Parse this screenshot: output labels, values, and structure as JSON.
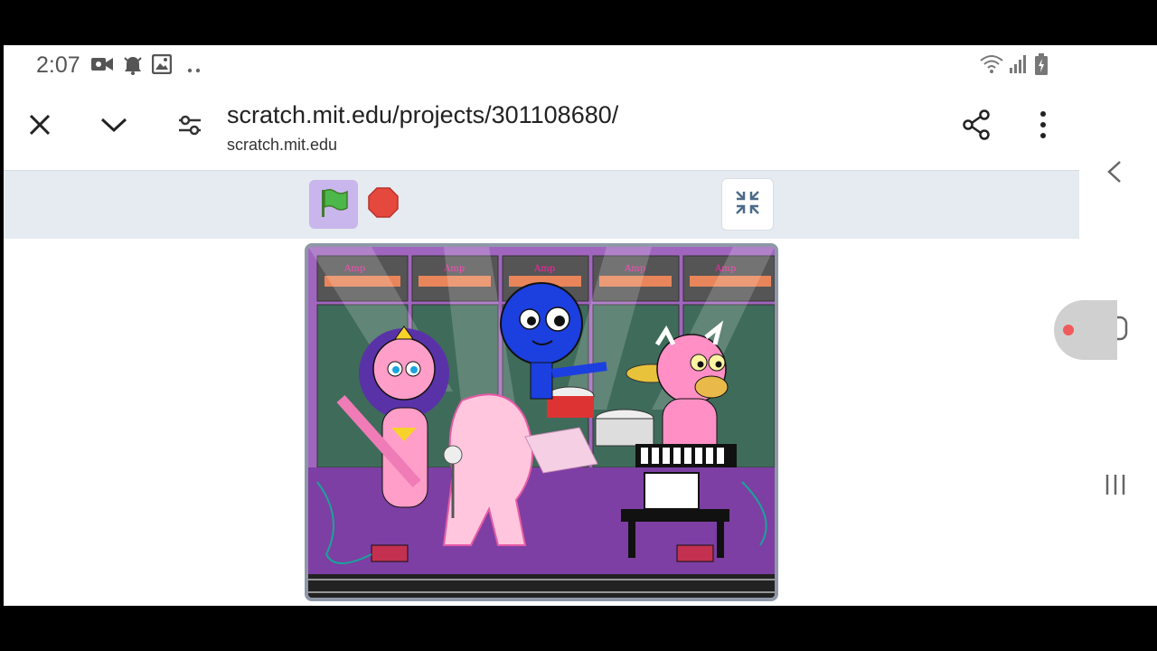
{
  "status_bar": {
    "time": "2:07",
    "left_icons": [
      "video-camera-icon",
      "alarm-bell-icon",
      "image-icon",
      "more-dots-icon"
    ],
    "right_icons": [
      "wifi-icon",
      "signal-icon",
      "battery-icon"
    ]
  },
  "browser": {
    "url": "scratch.mit.edu/projects/301108680/",
    "domain": "scratch.mit.edu",
    "buttons": [
      "close-icon",
      "chevron-down-icon",
      "tune-icon",
      "share-icon",
      "more-vertical-icon"
    ]
  },
  "scratch": {
    "controls": [
      "green-flag-icon",
      "stop-sign-icon",
      "exit-fullscreen-icon"
    ],
    "stage_label": "Amp"
  },
  "nav": {
    "buttons": [
      "back-icon",
      "home-icon",
      "recent-apps-icon"
    ]
  },
  "colors": {
    "toolbar_bg": "#e5ebf0",
    "flag_selected_bg": "#c9b6ec",
    "flag_green": "#3fa63a",
    "stop_red": "#e5483d",
    "stage_purple": "#8a4fb0"
  }
}
